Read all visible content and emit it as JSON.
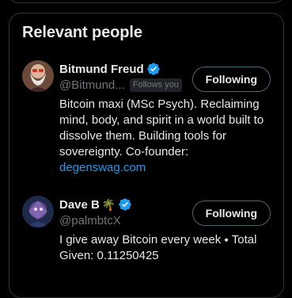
{
  "panel": {
    "title": "Relevant people"
  },
  "people": [
    {
      "name": "Bitmund Freud",
      "handle": "@Bitmund...",
      "follows_you": "Follows you",
      "button": "Following",
      "bio": "Bitcoin maxi (MSc Psych). Reclaiming mind, body, and spirit in a world built to dissolve them. Building tools for sovereignty. Co-founder:",
      "link": "degenswag.com",
      "verified": true
    },
    {
      "name": "Dave B",
      "emoji": "🌴",
      "handle": "@palmbtcX",
      "button": "Following",
      "bio": "I give away Bitcoin every week ⬩ Total Given: 0.11250425",
      "verified": true
    }
  ],
  "colors": {
    "accent": "#1d9bf0",
    "border": "#2f3336",
    "muted": "#71767b",
    "text": "#e7e9ea"
  }
}
